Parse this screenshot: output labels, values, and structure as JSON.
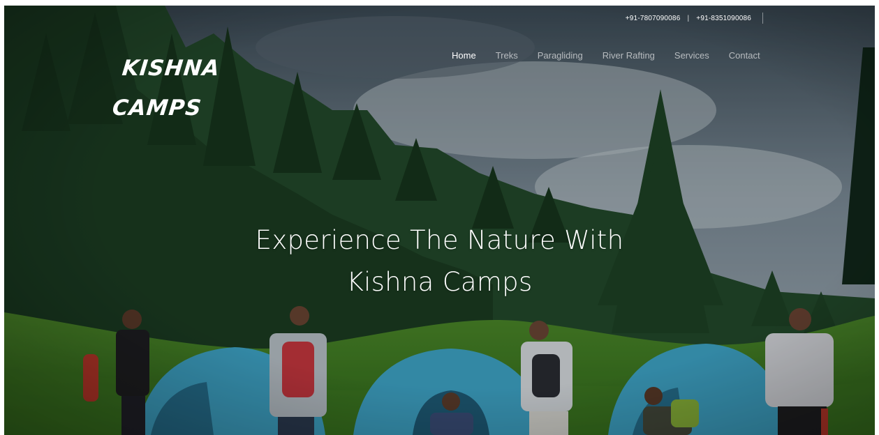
{
  "topbar": {
    "phone_1": "+91-7807090086",
    "separator": "|",
    "phone_2": "+91-8351090086"
  },
  "logo": {
    "line_1": "KISHNA",
    "line_2": "CAMPS"
  },
  "nav": {
    "items": [
      {
        "label": "Home",
        "active": true
      },
      {
        "label": "Treks",
        "active": false
      },
      {
        "label": "Paragliding",
        "active": false
      },
      {
        "label": "River Rafting",
        "active": false
      },
      {
        "label": "Services",
        "active": false
      },
      {
        "label": "Contact",
        "active": false
      }
    ]
  },
  "hero": {
    "headline_line_1": "Experience The Nature With",
    "headline_line_2": "Kishna Camps"
  },
  "colors": {
    "text": "#ffffff",
    "nav_inactive": "#b3c7c0",
    "tent": "#3fa6c9",
    "forest": "#1f4427",
    "grass": "#4f8f2c"
  }
}
